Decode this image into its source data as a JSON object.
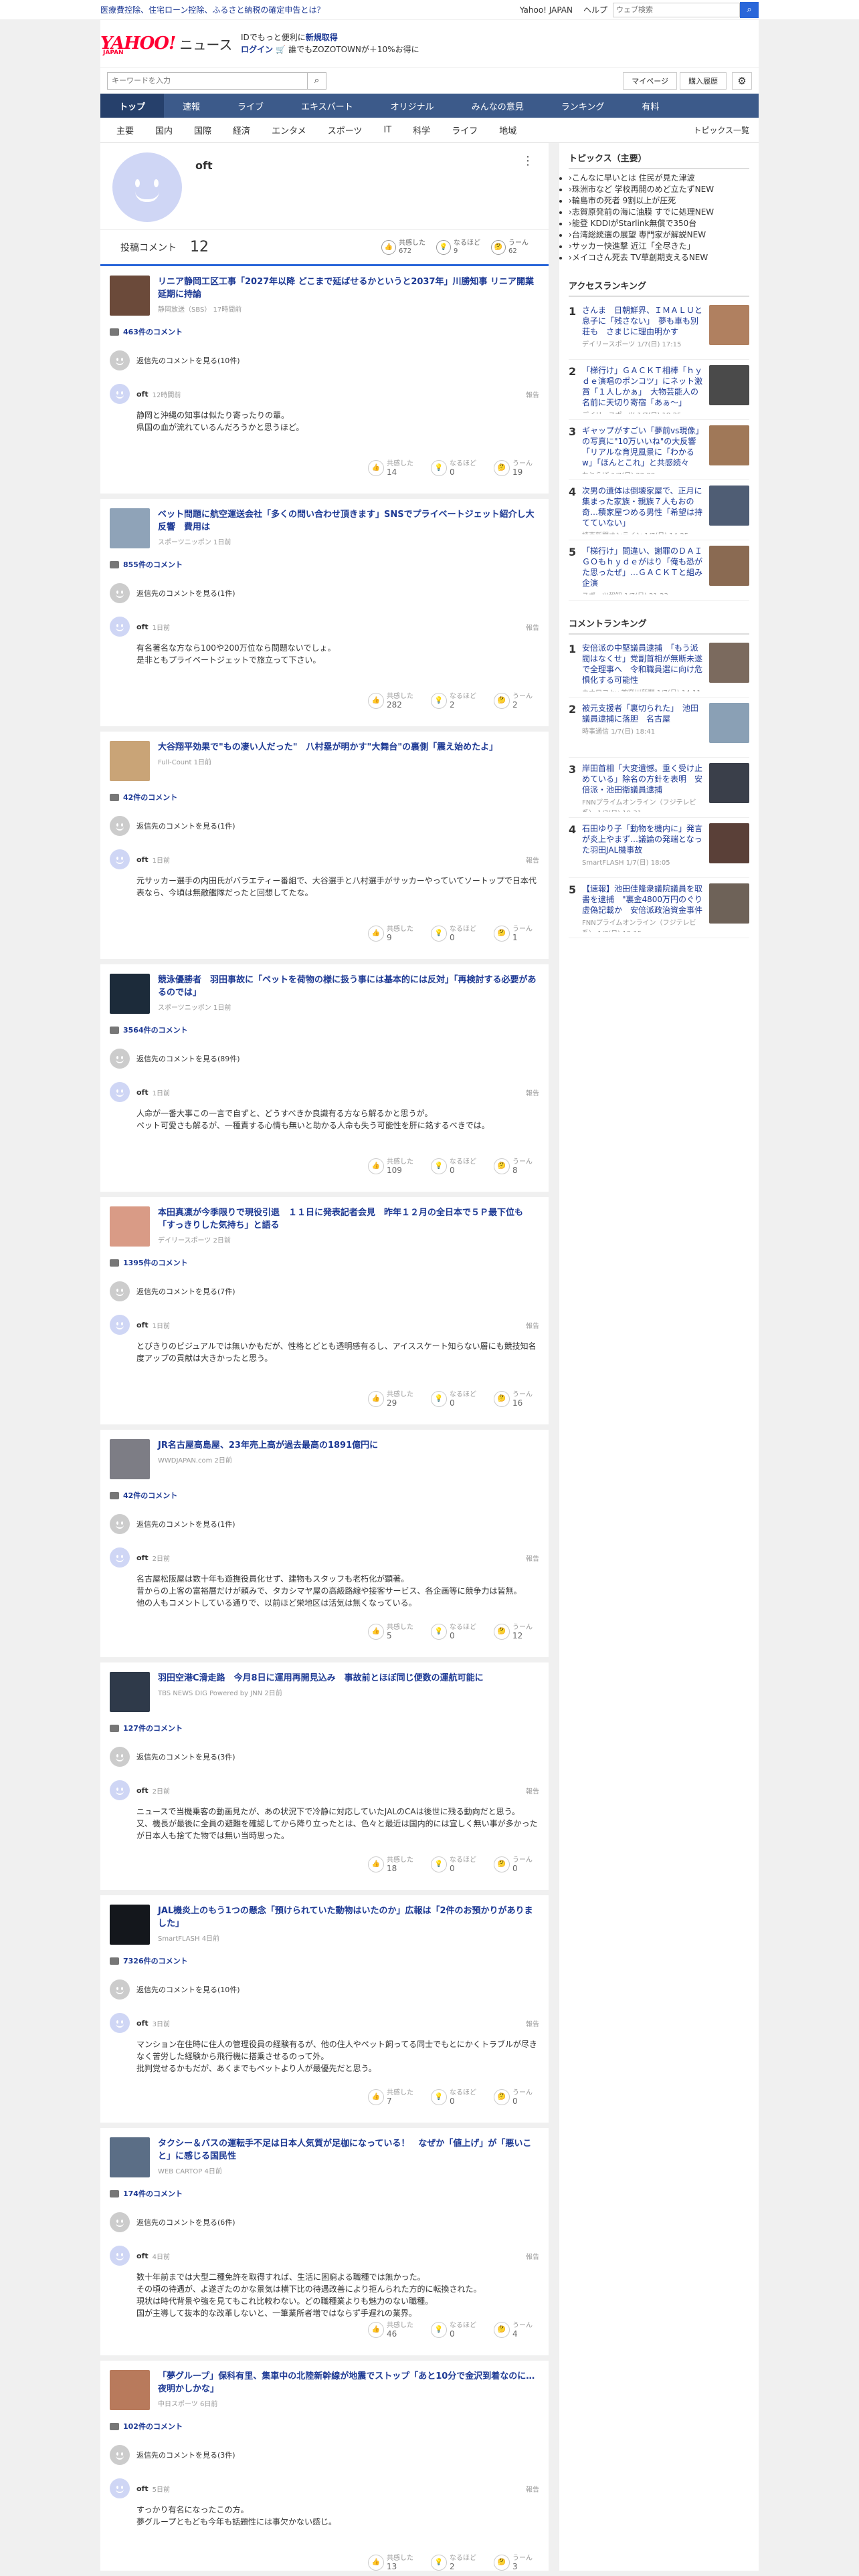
{
  "topbar": {
    "notice": "医療費控除、住宅ローン控除、ふるさと納税の確定申告とは？",
    "links": [
      "Yahoo! JAPAN",
      "ヘルプ"
    ],
    "search_placeholder": "ウェブ検索"
  },
  "header": {
    "logo_main": "YAHOO!",
    "logo_sub": "JAPAN",
    "logo_service": "ニュース",
    "promo_l1_pre": "IDでもっと便利に",
    "promo_l1_bold": "新規取得",
    "promo_l2_login": "ログイン",
    "promo_l2_rest": "🛒 誰でもZOZOTOWNが＋10%お得に"
  },
  "searchrow": {
    "placeholder": "キーワードを入力",
    "mypage": "マイページ",
    "purchase": "購入履歴"
  },
  "nav": [
    "トップ",
    "速報",
    "ライブ",
    "エキスパート",
    "オリジナル",
    "みんなの意見",
    "ランキング",
    "有料"
  ],
  "subnav": [
    "主要",
    "国内",
    "国際",
    "経済",
    "エンタメ",
    "スポーツ",
    "IT",
    "科学",
    "ライフ",
    "地域"
  ],
  "subnav_all": "トピックス一覧",
  "profile": {
    "name": "oft",
    "posted_label": "投稿コメント",
    "posted_count": "12",
    "rx": [
      {
        "label": "共感した",
        "value": "672"
      },
      {
        "label": "なるほど",
        "value": "9"
      },
      {
        "label": "うーん",
        "value": "62"
      }
    ]
  },
  "labels": {
    "reply_parent": "返信先のコメントを見る",
    "report": "報告",
    "agree": "共感した",
    "naruhodo": "なるほど",
    "uun": "うーん"
  },
  "cards": [
    {
      "title": "リニア静岡工区工事「2027年以降 どこまで延ばせるかというと2037年」川勝知事 リニア開業延期に持論",
      "src": "静岡放送（SBS） 17時間前",
      "count": "463件のコメント",
      "parent_count": "(10件)",
      "user": "oft",
      "time": "12時間前",
      "body": "静岡と沖縄の知事は似たり寄ったりの輩。\n県国の血が流れているんだろうかと思うほど。",
      "rx": [
        "14",
        "0",
        "19"
      ],
      "thumb": "#6b4a3a"
    },
    {
      "title": "ベット問題に航空運送会社「多くの問い合わせ頂きます」SNSでプライベートジェット紹介し大反響　費用は",
      "src": "スポーツニッポン 1日前",
      "count": "855件のコメント",
      "parent_count": "(1件)",
      "user": "oft",
      "time": "1日前",
      "body": "有名著名な方なら100や200万位なら問題ないでしょ。\n是非ともプライベートジェットで旅立って下さい。",
      "rx": [
        "282",
        "2",
        "2"
      ],
      "thumb": "#8fa3b8"
    },
    {
      "title": "大谷翔平効果で\"もの凄い人だった\"　八村塁が明かす\"大舞台\"の裏側「震え始めたよ」",
      "src": "Full-Count 1日前",
      "count": "42件のコメント",
      "parent_count": "(1件)",
      "user": "oft",
      "time": "1日前",
      "body": "元サッカー選手の内田氏がバラエティー番組で、大谷選手と八村選手がサッカーやっていてソートップで日本代表なら、今頃は無敵艦隊だったと回想してたな。",
      "rx": [
        "9",
        "0",
        "1"
      ],
      "thumb": "#c9a477"
    },
    {
      "title": "競泳優勝者　羽田事故に「ペットを荷物の様に扱う事には基本的には反対」「再検討する必要があるのでは」",
      "src": "スポーツニッポン 1日前",
      "count": "3564件のコメント",
      "parent_count": "(89件)",
      "user": "oft",
      "time": "1日前",
      "body": "人命が一番大事この一言で自ずと、どうすべきか良識有る方なら解るかと思うが。\nペット可愛さも解るが、一種責する心情も無いと助かる人命も失う可能性を肝に銘するべきでは。",
      "rx": [
        "109",
        "0",
        "8"
      ],
      "thumb": "#1c2b3a"
    },
    {
      "title": "本田真凜が今季限りで現役引退　１１日に発表記者会見　昨年１２月の全日本で５Ｐ最下位も「すっきりした気持ち」と語る",
      "src": "デイリースポーツ 2日前",
      "count": "1395件のコメント",
      "parent_count": "(7件)",
      "user": "oft",
      "time": "1日前",
      "body": "とびきりのビジュアルでは無いかもだが、性格とどとも透明感有るし、アイススケート知らない層にも競技知名度アップの貢献は大きかったと思う。",
      "rx": [
        "29",
        "0",
        "16"
      ],
      "thumb": "#d99b86"
    },
    {
      "title": "JR名古屋高島屋、23年売上高が過去最高の1891億円に",
      "src": "WWDJAPAN.com 2日前",
      "count": "42件のコメント",
      "parent_count": "(1件)",
      "user": "oft",
      "time": "2日前",
      "body": "名古屋松阪屋は数十年も遊撫役員化せず、建物もスタッフも老朽化が顕著。\n昔からの上客の富裕層だけが頼みで、タカシマヤ屋の高級路線や接客サービス、各企画等に競争力は皆無。\n他の人もコメントしている通りで、以前ほど栄地区は活気は無くなっている。",
      "rx": [
        "5",
        "0",
        "12"
      ],
      "thumb": "#7d7d85"
    },
    {
      "title": "羽田空港C滑走路　今月8日に運用再開見込み　事故前とほぼ同じ便数の運航可能に",
      "src": "TBS NEWS DIG Powered by JNN 2日前",
      "count": "127件のコメント",
      "parent_count": "(3件)",
      "user": "oft",
      "time": "2日前",
      "body": "ニュースで当機乗客の動画見たが、あの状況下で冷静に対応していたJALのCAは後世に残る動向だと思う。\n又、機長が最後に全員の避難を確認してから降り立ったとは、色々と最近は国内的には宜しく無い事が多かったが日本人も捨てた物では無い当時思った。",
      "rx": [
        "18",
        "0",
        "0"
      ],
      "thumb": "#2f3a4a"
    },
    {
      "title": "JAL機炎上のもう1つの懸念「預けられていた動物はいたのか」広報は「2件のお預かりがありました」",
      "src": "SmartFLASH 4日前",
      "count": "7326件のコメント",
      "parent_count": "(10件)",
      "user": "oft",
      "time": "3日前",
      "body": "マンション在住時に住人の管理役員の経験有るが、他の住人やペット飼ってる同士でもとにかくトラブルが尽きなく苦労した経験から飛行機に搭乗させるのって外。\n批判覚せるかもだが、あくまでもペットより人が最優先だと思う。",
      "rx": [
        "7",
        "0",
        "0"
      ],
      "thumb": "#14171c"
    },
    {
      "title": "タクシー＆バスの運転手不足は日本人気質が足枷になっている！　なぜか「値上げ」が「悪いこと」に感じる国民性",
      "src": "WEB CARTOP 4日前",
      "count": "174件のコメント",
      "parent_count": "(6件)",
      "user": "oft",
      "time": "4日前",
      "body": "数十年前までは大型二種免許を取得すれば、生活に困窮よる職種では無かった。\nその頃の待遇が、よ遂ぎたのかな景気は横下比の待遇改善により拒んられた方的に転換された。\n現状は時代背景や強を見てもこれ比較わない。どの職種業よりも魅力のない職種。\n国が主導して抜本的な改革しないと、一筆業所者増ではならず手遅れの業界。",
      "rx": [
        "46",
        "0",
        "4"
      ],
      "thumb": "#5b6e86"
    },
    {
      "title": "「夢グループ」保科有里、集車中の北陸新幹線が地震でストップ「あと10分で金沢到着なのに…夜明かしかな」",
      "src": "中日スポーツ 6日前",
      "count": "102件のコメント",
      "parent_count": "(3件)",
      "user": "oft",
      "time": "5日前",
      "body": "すっかり有名になったこの方。\n夢グループともども今年も話題性には事欠かない感じ。",
      "rx": [
        "13",
        "2",
        "3"
      ],
      "thumb": "#b87a5c"
    }
  ],
  "side": {
    "topics_title": "トピックス（主要）",
    "topics": [
      {
        "t": "こんなに早いとは 住民が見た津波",
        "new": false
      },
      {
        "t": "珠洲市など 学校再開のめど立たず",
        "new": true
      },
      {
        "t": "輪島市の死者 9割以上が圧死",
        "new": false
      },
      {
        "t": "志賀原発前の海に油膜 すでに処理",
        "new": true
      },
      {
        "t": "能登 KDDIがStarlink無償で350台",
        "new": false
      },
      {
        "t": "台湾総統選の展望 専門家が解説",
        "new": true
      },
      {
        "t": "サッカー快進撃 近江「全尽きた」",
        "new": false
      },
      {
        "t": "メイコさん死去 TV草創期支える",
        "new": true
      }
    ],
    "access_title": "アクセスランキング",
    "access": [
      {
        "n": "1",
        "t": "さんま　日朝鮮界、ＩＭＡＬＵと息子に「残さない」　夢も車も別荘も　さまじに理由明かす",
        "s": "デイリースポーツ 1/7(日) 17:15",
        "c": "#b08060"
      },
      {
        "n": "2",
        "t": "「梯行け」ＧＡＣＫＴ相棒「ｈｙｄｅ演唱のポンコツ」にネット激賞「１人しかぁ」　大物芸能人の名前に天切り寄宿「あぁ～」",
        "s": "デイリースポーツ 1/7(日) 18:25",
        "c": "#4a4a4a"
      },
      {
        "n": "3",
        "t": "ギャップがすごい「夢前vs現像」の写真に\"10万いいね\"の大反響「リアルな育児風景に「わかるw」「ほんとこれ」と共感続々",
        "s": "ねとらぼ 1/7(日) 22:00",
        "c": "#a07858"
      },
      {
        "n": "4",
        "t": "次男の遺体は倒壊家屋で、正月に集まった家族・親族７人もおの奇…積家屋つめる男性「希望は持てていない」",
        "s": "読売新聞オンライン 1/7(日) 14:25",
        "c": "#4f5d74"
      },
      {
        "n": "5",
        "t": "「梯行け」問違い、謝罪のＤＡＩＧＯもｈｙｄｅがはり「俺も恐がた思ったぜ」…ＧＡＣＫＴと組み企演",
        "s": "スポーツ報知 1/7(日) 21:23",
        "c": "#8a6a52"
      }
    ],
    "comment_title": "コメントランキング",
    "comment": [
      {
        "n": "1",
        "t": "安倍派の中堅議員逮捕　「もう派閥はなくせ」党副首相が無断未遂で全理事へ　令和職員選に向け危惧化する可能性",
        "s": "カナロコ by 神奈川新聞 1/7(日) 14:11",
        "c": "#7b6a5e"
      },
      {
        "n": "2",
        "t": "被元支援者「裏切られた」　池田議員逮捕に落胆　名古屋",
        "s": "時事通信 1/7(日) 18:41",
        "c": "#8aa0b5"
      },
      {
        "n": "3",
        "t": "岸田首相「大変遺憾。重く受け止めている」除名の方針を表明　安倍派・池田衛議員逮捕",
        "s": "FNNプライムオンライン（フジテレビ系） 1/7(日) 19:31",
        "c": "#3a3f4a"
      },
      {
        "n": "4",
        "t": "石田ゆり子「動物を機内に」発言が炎上やまず…議論の発端となった羽田JAL機事故",
        "s": "SmartFLASH 1/7(日) 18:05",
        "c": "#5a4038"
      },
      {
        "n": "5",
        "t": "【速報】池田佳隆衆議院議員を取書を逮捕　\"裏金4800万円のぐり虚偽記載か　安倍派政治資金事件",
        "s": "FNNプライムオンライン（フジテレビ系） 1/7(日) 12:15",
        "c": "#6e6258"
      }
    ]
  }
}
